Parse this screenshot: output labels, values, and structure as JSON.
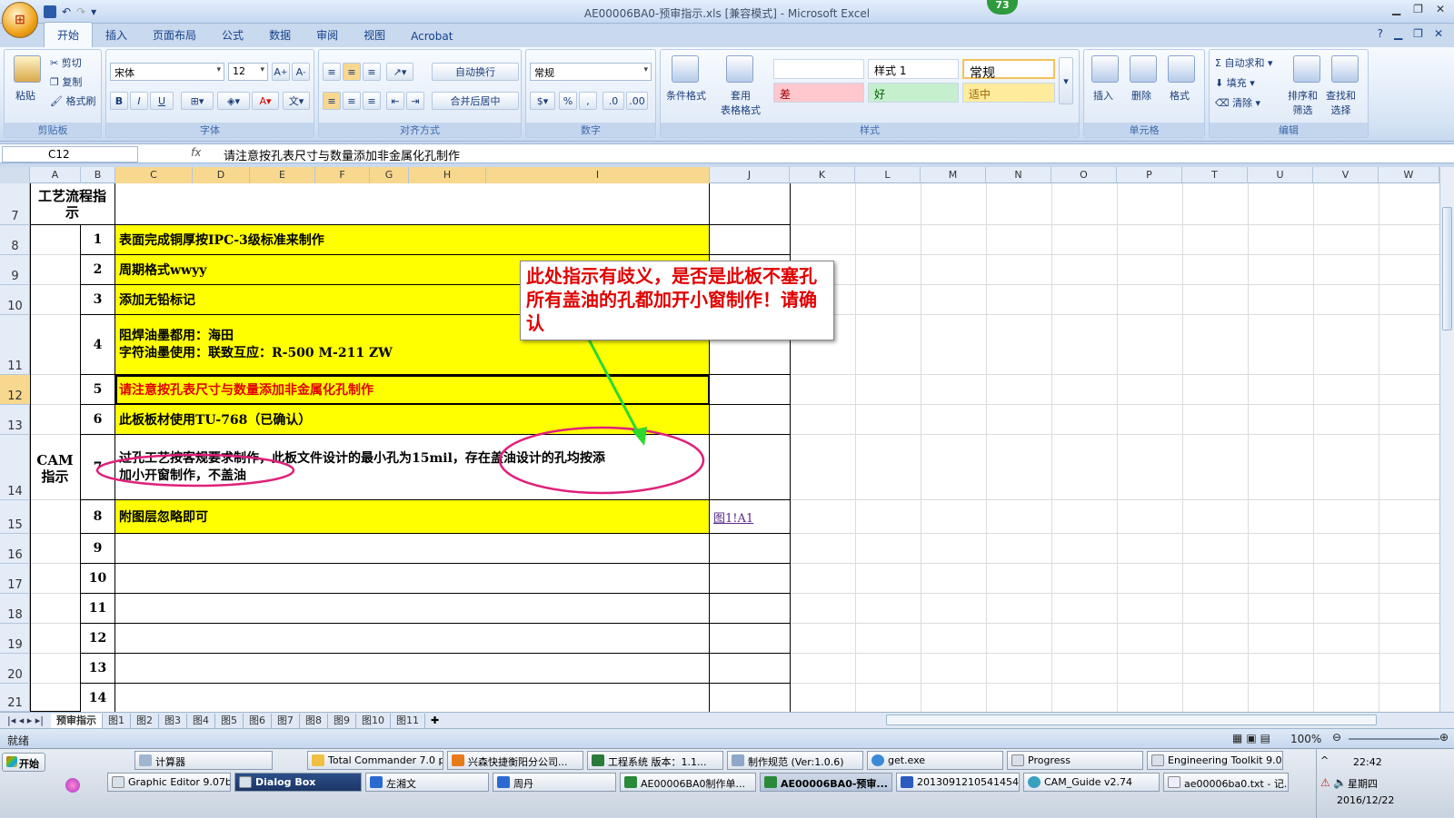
{
  "window": {
    "title": "AE00006BA0-预审指示.xls  [兼容模式] - Microsoft Excel",
    "badge": "73"
  },
  "ribbon": {
    "tabs": [
      "开始",
      "插入",
      "页面布局",
      "公式",
      "数据",
      "审阅",
      "视图",
      "Acrobat"
    ],
    "clipboard": {
      "paste": "粘贴",
      "cut": "剪切",
      "copy": "复制",
      "format_painter": "格式刷",
      "caption": "剪贴板"
    },
    "font": {
      "name": "宋体",
      "size": "12",
      "caption": "字体"
    },
    "alignment": {
      "wrap": "自动换行",
      "merge": "合并后居中",
      "caption": "对齐方式"
    },
    "number": {
      "format": "常规",
      "caption": "数字"
    },
    "styles": {
      "cond_format": "条件格式",
      "table_format": "套用\n表格格式",
      "blank": "",
      "style1": "样式 1",
      "normal": "常规",
      "bad": "差",
      "good": "好",
      "neutral": "适中",
      "caption": "样式"
    },
    "cells": {
      "insert": "插入",
      "delete": "删除",
      "format": "格式",
      "caption": "单元格"
    },
    "editing": {
      "autosum": "自动求和",
      "fill": "填充",
      "clear": "清除",
      "sort": "排序和\n筛选",
      "find": "查找和\n选择",
      "caption": "编辑"
    }
  },
  "formula_bar": {
    "name_box": "C12",
    "fx": "fx",
    "content": "请注意按孔表尺寸与数量添加非金属化孔制作"
  },
  "columns": [
    "A",
    "B",
    "C",
    "D",
    "E",
    "F",
    "G",
    "H",
    "I",
    "J",
    "K",
    "L",
    "M",
    "N",
    "O",
    "P",
    "T",
    "U",
    "V",
    "W"
  ],
  "rows": [
    "7",
    "8",
    "9",
    "10",
    "11",
    "12",
    "13",
    "14",
    "15",
    "16",
    "17",
    "18",
    "19",
    "20",
    "21"
  ],
  "sheet": {
    "header_label": "工艺流程指示",
    "cam_label": "CAM\n指示",
    "items": [
      {
        "no": "1",
        "text": "表面完成铜厚按IPC-3级标准来制作"
      },
      {
        "no": "2",
        "text": "周期格式wwyy"
      },
      {
        "no": "3",
        "text": "添加无铅标记"
      },
      {
        "no": "4",
        "text": "阻焊油墨都用：海田\n字符油墨使用：联致互应：R-500 M-211 ZW"
      },
      {
        "no": "5",
        "text": "请注意按孔表尺寸与数量添加非金属化孔制作"
      },
      {
        "no": "6",
        "text": "此板板材使用TU-768（已确认）"
      },
      {
        "no": "7",
        "text": "过孔工艺按客规要求制作，此板文件设计的最小孔为15mil，存在盖油设计的孔均按添\n加小开窗制作，不盖油"
      },
      {
        "no": "8",
        "text": "附图层忽略即可"
      },
      {
        "no": "9",
        "text": ""
      },
      {
        "no": "10",
        "text": ""
      },
      {
        "no": "11",
        "text": ""
      },
      {
        "no": "12",
        "text": ""
      },
      {
        "no": "13",
        "text": ""
      },
      {
        "no": "14",
        "text": ""
      }
    ],
    "link": "图1!A1",
    "note": "此处指示有歧义，是否是此板不塞孔  所有盖油的孔都加开小窗制作！请确认"
  },
  "sheet_tabs": [
    "预审指示",
    "图1",
    "图2",
    "图3",
    "图4",
    "图5",
    "图6",
    "图7",
    "图8",
    "图9",
    "图10",
    "图11"
  ],
  "status": {
    "ready": "就绪",
    "zoom": "100%"
  },
  "taskbar": {
    "start": "开始",
    "row1": [
      "计算器",
      "Total Commander 7.0 p...",
      "兴森快捷衡阳分公司...",
      "工程系统  版本：1.1...",
      "制作规范 (Ver:1.0.6)",
      "get.exe",
      "Progress",
      "Engineering Toolkit 9.0..."
    ],
    "row2": [
      "Graphic Editor 9.07b...",
      "Dialog Box",
      "左湘文",
      "周丹",
      "AE00006BA0制作单...",
      "AE00006BA0-预审...",
      "20130912105414543...",
      "CAM_Guide v2.74",
      "ae00006ba0.txt - 记..."
    ],
    "time": "22:42",
    "weekday": "星期四",
    "date": "2016/12/22"
  }
}
